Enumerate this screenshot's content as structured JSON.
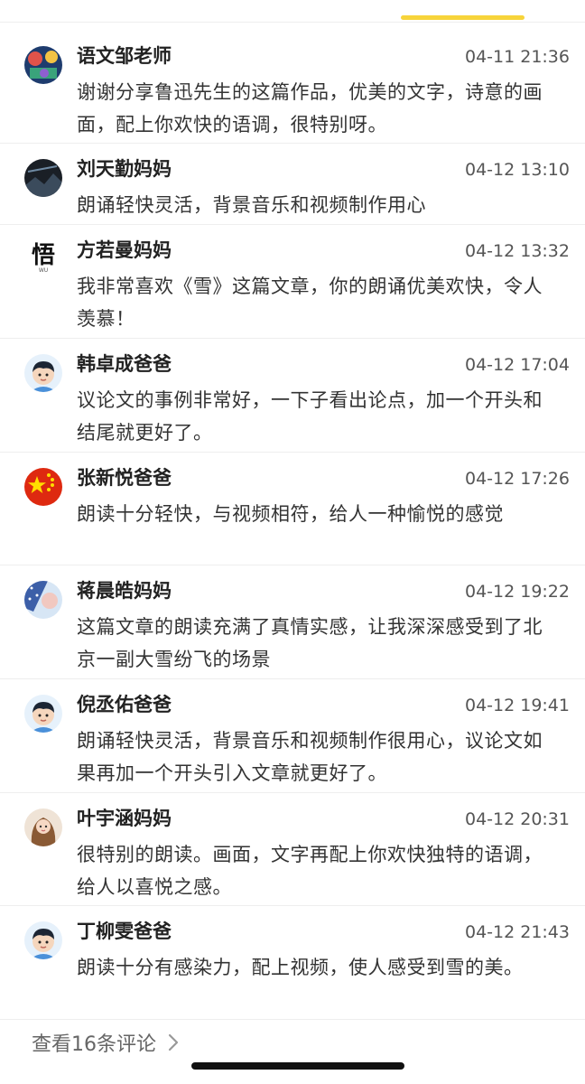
{
  "comments": [
    {
      "author": "语文邹老师",
      "time": "04-11 21:36",
      "text": "谢谢分享鲁迅先生的这篇作品，优美的文字，诗意的画面，配上你欢快的语调，很特别呀。",
      "avatar": "colorful-art-avatar"
    },
    {
      "author": "刘天勤妈妈",
      "time": "04-12 13:10",
      "text": "朗诵轻快灵活，背景音乐和视频制作用心",
      "avatar": "dark-landscape-avatar"
    },
    {
      "author": "方若曼妈妈",
      "time": "04-12 13:32",
      "text": "我非常喜欢《雪》这篇文章，你的朗诵优美欢快，令人羡慕！",
      "avatar": "calligraphy-avatar",
      "avatar_text": "悟",
      "avatar_sub": "WU"
    },
    {
      "author": "韩卓成爸爸",
      "time": "04-12 17:04",
      "text": "议论文的事例非常好，一下子看出论点，加一个开头和结尾就更好了。",
      "avatar": "cartoon-boy-avatar"
    },
    {
      "author": "张新悦爸爸",
      "time": "04-12 17:26",
      "text": "朗读十分轻快，与视频相符，给人一种愉悦的感觉",
      "avatar": "star-flag-avatar"
    },
    {
      "author": "蒋晨皓妈妈",
      "time": "04-12 19:22",
      "text": "这篇文章的朗读充满了真情实感，让我深深感受到了北京一副大雪纷飞的场景",
      "avatar": "snow-scene-avatar"
    },
    {
      "author": "倪丞佑爸爸",
      "time": "04-12 19:41",
      "text": "朗诵轻快灵活，背景音乐和视频制作很用心，议论文如果再加一个开头引入文章就更好了。",
      "avatar": "cartoon-boy-avatar"
    },
    {
      "author": "叶宇涵妈妈",
      "time": "04-12 20:31",
      "text": "很特别的朗读。画面，文字再配上你欢快独特的语调，给人以喜悦之感。",
      "avatar": "girl-photo-avatar"
    },
    {
      "author": "丁柳雯爸爸",
      "time": "04-12 21:43",
      "text": "朗读十分有感染力，配上视频，使人感受到雪的美。",
      "avatar": "cartoon-boy-avatar"
    }
  ],
  "footer": {
    "more_label": "查看16条评论"
  },
  "colors": {
    "accent": "#f7d43a",
    "divider": "#eeeeee",
    "text": "#333333"
  }
}
